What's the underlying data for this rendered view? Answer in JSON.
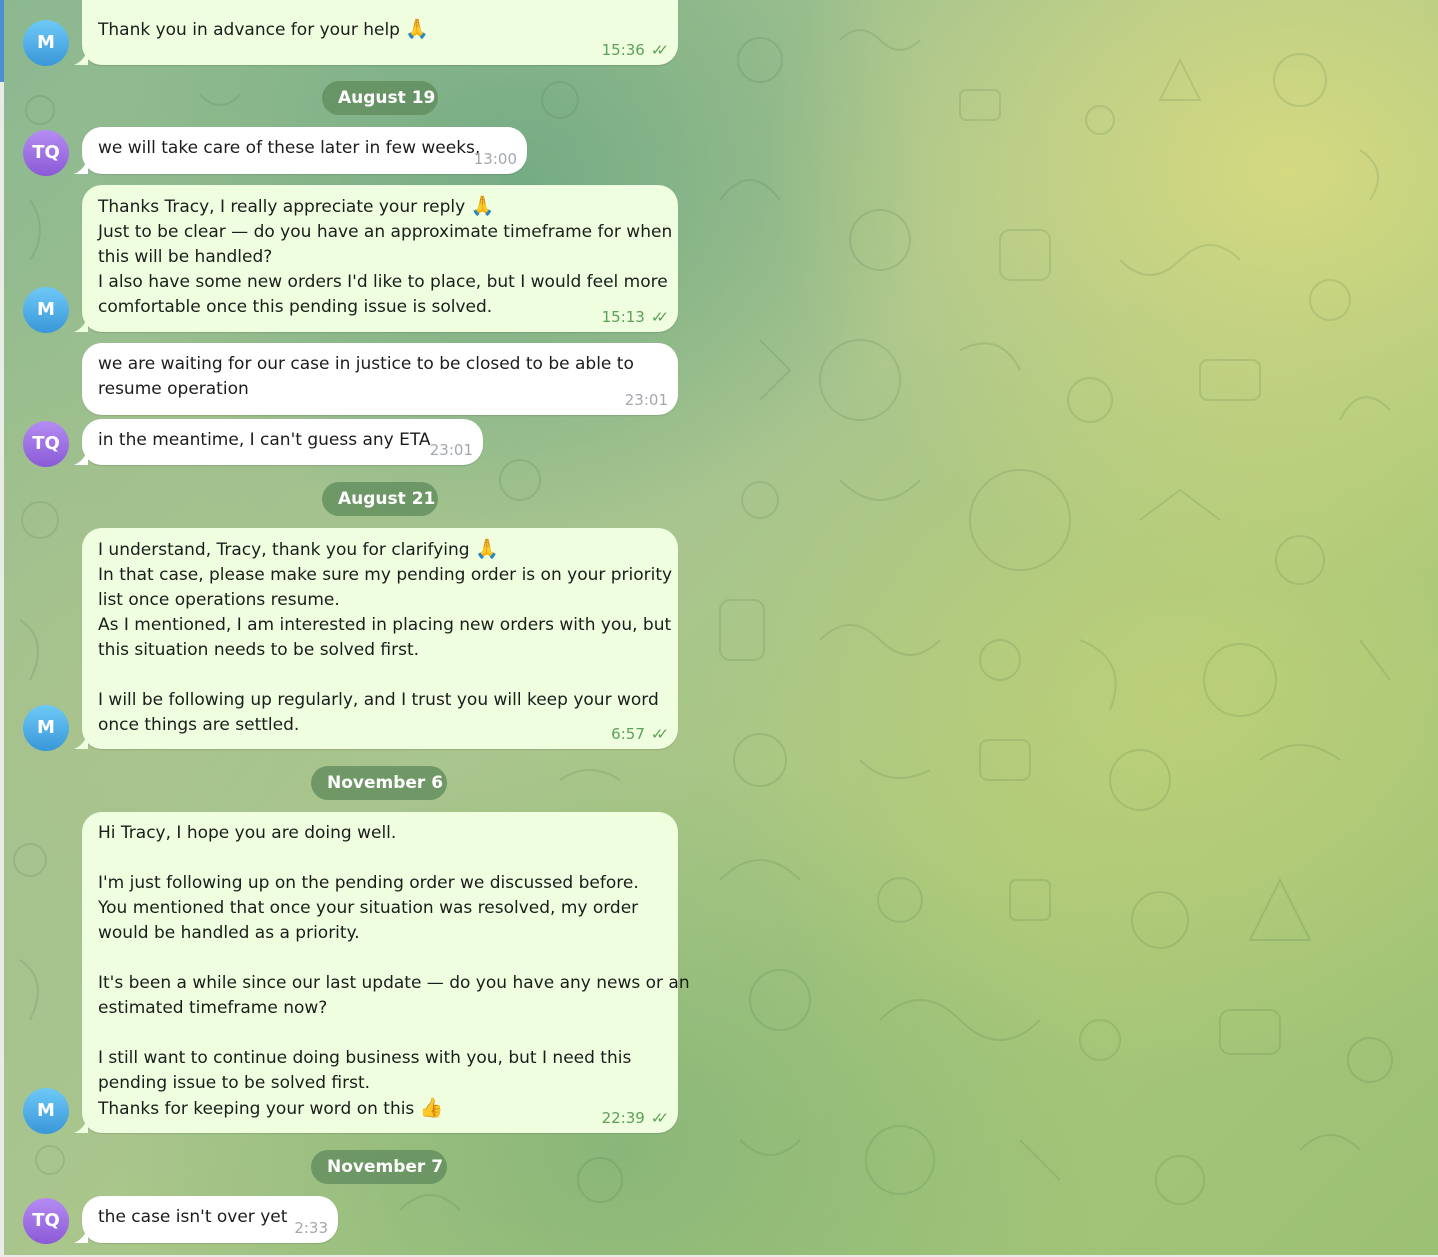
{
  "colors": {
    "outgoing_bubble": "#eefedf",
    "incoming_bubble": "#ffffff",
    "outgoing_time": "#5da05a",
    "incoming_time": "#a3a8ad",
    "date_pill": "#608c5c",
    "avatar_m": "#3a97d8",
    "avatar_tq": "#8a5ad6"
  },
  "avatars": {
    "m": "M",
    "tq": "TQ"
  },
  "dates": {
    "aug19": "August 19",
    "aug21": "August 21",
    "nov6": "November 6",
    "nov7": "November 7"
  },
  "messages": {
    "m1": {
      "sender": "M",
      "lines": [
        "Thank you in advance for your help"
      ],
      "emoji": "folded-hands",
      "time": "15:36",
      "status": "read"
    },
    "tq1": {
      "sender": "TQ",
      "lines": [
        "we will take care of these later in few weeks,"
      ],
      "time": "13:00"
    },
    "m2": {
      "sender": "M",
      "lines": [
        "Thanks Tracy, I really appreciate your reply",
        "Just to be clear — do you have an approximate timeframe for when",
        "this will be handled?",
        "I also have some new orders I'd like to place, but I would feel more",
        "comfortable once this pending issue is solved."
      ],
      "emoji": "folded-hands",
      "time": "15:13",
      "status": "read"
    },
    "tq2": {
      "sender": "TQ",
      "lines": [
        "we are waiting for our case in justice to be closed to be able to",
        "resume operation"
      ],
      "time": "23:01"
    },
    "tq3": {
      "sender": "TQ",
      "lines": [
        "in the meantime, I can't guess any ETA"
      ],
      "time": "23:01"
    },
    "m3": {
      "sender": "M",
      "lines": [
        "I understand, Tracy, thank you for clarifying",
        "In that case, please make sure my pending order is on your priority",
        "list once operations resume.",
        "As I mentioned, I am interested in placing new orders with you, but",
        "this situation needs to be solved first.",
        "",
        "I will be following up regularly, and I trust you will keep your word",
        "once things are settled."
      ],
      "emoji": "folded-hands",
      "time": "6:57",
      "status": "read"
    },
    "m4": {
      "sender": "M",
      "lines": [
        "Hi Tracy, I hope you are doing well.",
        "",
        "I'm just following up on the pending order we discussed before.",
        "You mentioned that once your situation was resolved, my order",
        "would be handled as a priority.",
        "",
        "It's been a while since our last update — do you have any news or an",
        "estimated timeframe now?",
        "",
        "I still want to continue doing business with you, but I need this",
        "pending issue to be solved first.",
        "Thanks for keeping your word on this"
      ],
      "emoji": "thumbs-up",
      "time": "22:39",
      "status": "read"
    },
    "tq4": {
      "sender": "TQ",
      "lines": [
        "the case isn't over yet"
      ],
      "time": "2:33"
    }
  }
}
